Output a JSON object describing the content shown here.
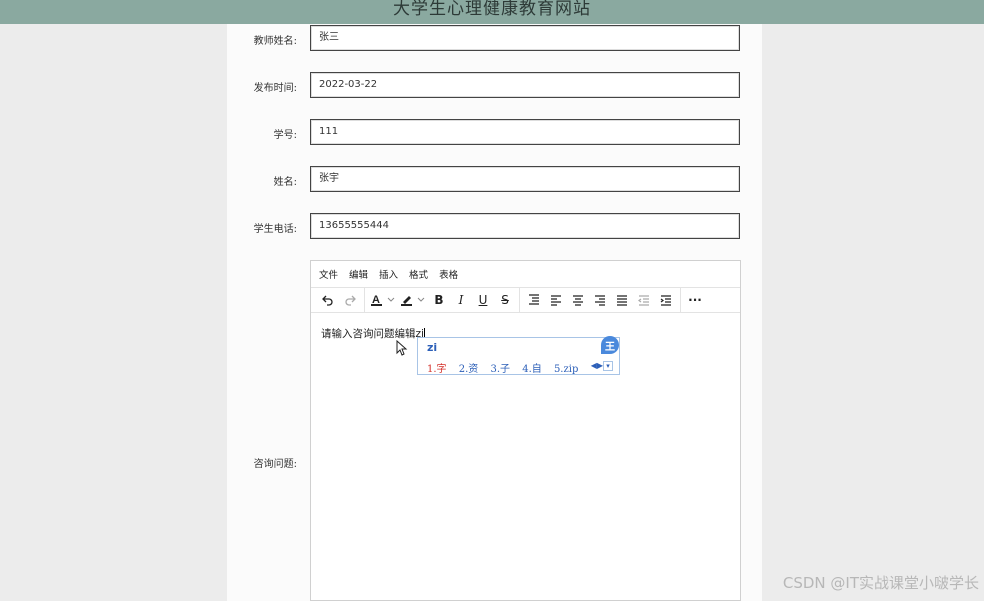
{
  "site": {
    "title": "大学生心理健康教育网站"
  },
  "form": {
    "teacher_name": {
      "label": "教师姓名:",
      "value": "张三"
    },
    "publish_time": {
      "label": "发布时间:",
      "value": "2022-03-22"
    },
    "student_id": {
      "label": "学号:",
      "value": "111"
    },
    "name": {
      "label": "姓名:",
      "value": "张宇"
    },
    "student_phone": {
      "label": "学生电话:",
      "value": "13655555444"
    },
    "question": {
      "label": "咨询问题:"
    }
  },
  "editor": {
    "menus": [
      "文件",
      "编辑",
      "插入",
      "格式",
      "表格"
    ],
    "content": "请输入咨询问题编辑zi",
    "toolbar_icons": [
      "undo-icon",
      "redo-icon",
      "font-color-icon",
      "highlight-icon",
      "bold-icon",
      "italic-icon",
      "underline-icon",
      "strikethrough-icon",
      "line-height-icon",
      "align-left-icon",
      "align-center-icon",
      "align-right-icon",
      "align-justify-icon",
      "outdent-icon",
      "indent-icon",
      "more-icon"
    ]
  },
  "ime": {
    "input": "zi",
    "candidates": [
      "1.字",
      "2.资",
      "3.子",
      "4.自",
      "5.zip"
    ],
    "logo": "王"
  },
  "watermark": "CSDN @IT实战课堂小啵学长",
  "colors": {
    "topbar": "#8aa9a0",
    "ime_accent": "#2c5fb8",
    "ime_first": "#d4312b"
  }
}
